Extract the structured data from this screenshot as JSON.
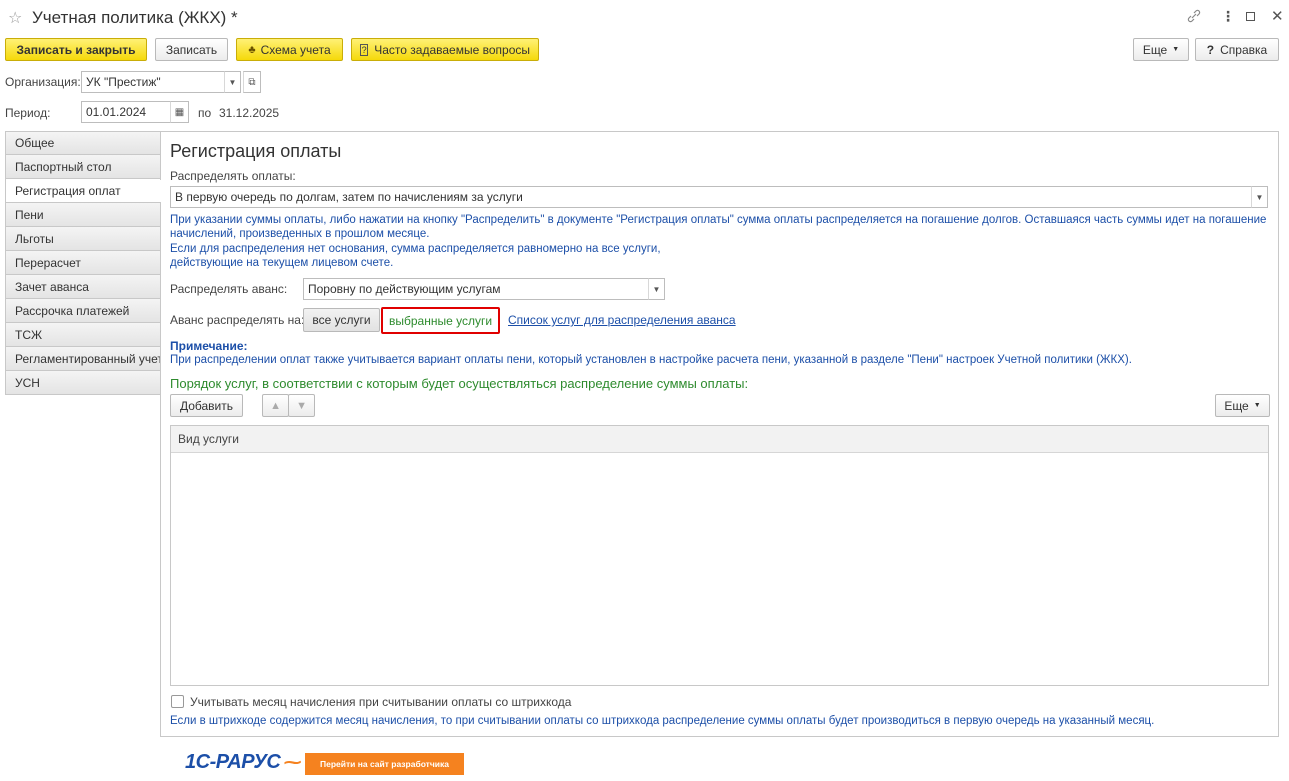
{
  "window": {
    "title": "Учетная политика (ЖКХ) *"
  },
  "toolbar": {
    "save_close": "Записать и закрыть",
    "save": "Записать",
    "scheme": "Схема учета",
    "faq": "Часто задаваемые вопросы",
    "more": "Еще",
    "help": "Справка"
  },
  "organization": {
    "label": "Организация:",
    "value": "УК \"Престиж\""
  },
  "period": {
    "label": "Период:",
    "from": "01.01.2024",
    "to_label": "по",
    "to": "31.12.2025"
  },
  "tabs": [
    "Общее",
    "Паспортный стол",
    "Регистрация оплат",
    "Пени",
    "Льготы",
    "Перерасчет",
    "Зачет аванса",
    "Рассрочка платежей",
    "ТСЖ",
    "Регламентированный учет",
    "УСН"
  ],
  "main": {
    "heading": "Регистрация оплаты",
    "distribute_label": "Распределять оплаты:",
    "distribute_value": "В первую очередь по долгам, затем по начислениям за услуги",
    "info_line1": "При указании суммы оплаты, либо нажатии на кнопку \"Распределить\" в документе \"Регистрация оплаты\" сумма оплаты распределяется на погашение долгов. Оставшаяся часть суммы идет на погашение",
    "info_line2": "начислений, произведенных в прошлом месяце.",
    "info_line3": "Если для распределения нет основания, сумма распределяется равномерно на все услуги,",
    "info_line4": "действующие на текущем лицевом счете.",
    "advance_label": "Распределять аванс:",
    "advance_value": "Поровну по действующим услугам",
    "advance_on_label": "Аванс распределять на:",
    "all_services": "все услуги",
    "selected_services": "выбранные услуги",
    "service_list_link": "Список услуг для распределения аванса",
    "note_title": "Примечание:",
    "note_text": "При распределении оплат также учитывается вариант оплаты пени, который установлен в настройке расчета пени, указанной в разделе \"Пени\" настроек Учетной политики (ЖКХ).",
    "order_title": "Порядок услуг, в соответствии с которым будет осуществляться распределение суммы оплаты:",
    "add_button": "Добавить",
    "more_button": "Еще",
    "table_header": "Вид услуги",
    "barcode_checkbox": "Учитывать месяц начисления при считывании оплаты со штрихкода",
    "barcode_note": "Если в штрихкоде содержится месяц начисления, то при считывании оплаты со штрихкода распределение суммы оплаты будет производиться в первую очередь на указанный месяц."
  },
  "footer": {
    "logo": "1С-РАРУС",
    "dev_button": "Перейти на сайт разработчика"
  },
  "colors": {
    "accent_yellow": "#f5d90a",
    "link_blue": "#1c4fa8",
    "green_text": "#2e8b2e",
    "highlight_red": "#e00000",
    "dev_orange": "#f5821f"
  }
}
